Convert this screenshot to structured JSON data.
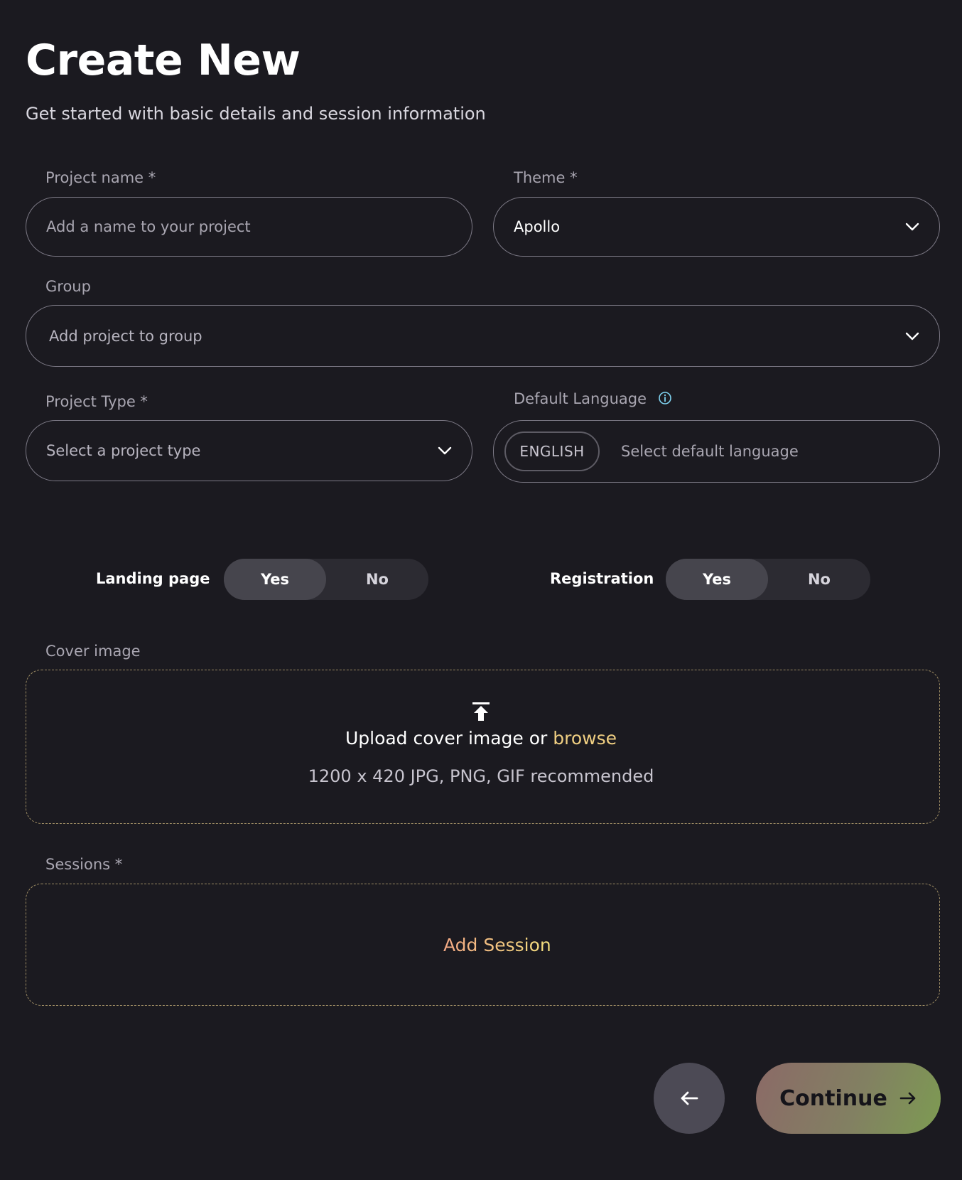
{
  "header": {
    "title": "Create New",
    "subtitle": "Get started with basic details and session information"
  },
  "form": {
    "project_name": {
      "label": "Project name *",
      "placeholder": "Add a name to your project",
      "value": ""
    },
    "theme": {
      "label": "Theme *",
      "value": "Apollo",
      "icon": "chevron-down-icon"
    },
    "group": {
      "label": "Group",
      "placeholder": "Add project to group",
      "icon": "chevron-down-icon"
    },
    "project_type": {
      "label": "Project Type *",
      "placeholder": "Select a project type",
      "icon": "chevron-down-icon"
    },
    "default_language": {
      "label": "Default Language",
      "chip": "ENGLISH",
      "placeholder": "Select default language",
      "icon": "info-icon"
    },
    "landing_page": {
      "label": "Landing page",
      "options": [
        "Yes",
        "No"
      ],
      "selected": "Yes"
    },
    "registration": {
      "label": "Registration",
      "options": [
        "Yes",
        "No"
      ],
      "selected": "Yes"
    },
    "cover_image": {
      "label": "Cover image",
      "upload_text": "Upload cover image or",
      "browse_text": "browse",
      "hint": "1200 x 420 JPG, PNG, GIF recommended",
      "icon": "upload-icon"
    },
    "sessions": {
      "label": "Sessions *",
      "add_label": "Add Session",
      "icon": "plus-icon"
    }
  },
  "footer": {
    "back_icon": "arrow-left-icon",
    "continue_label": "Continue",
    "continue_icon": "arrow-right-icon"
  },
  "colors": {
    "background": "#1b1a20",
    "accent_peach": "#f2a884",
    "accent_yellow": "#f3e07e",
    "info_blue": "#7fd3f0"
  }
}
